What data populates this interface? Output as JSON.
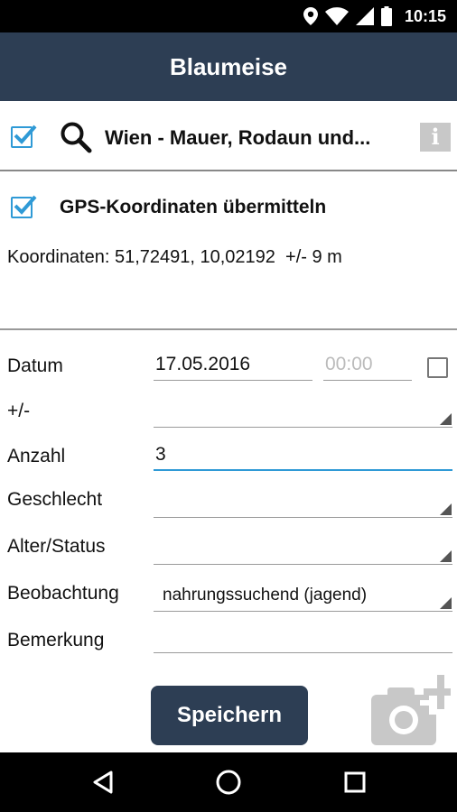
{
  "status_bar": {
    "time": "10:15",
    "icons": [
      "location-icon",
      "wifi-icon",
      "signal-icon",
      "battery-icon"
    ]
  },
  "app_bar": {
    "title": "Blaumeise"
  },
  "location": {
    "checked": true,
    "name": "Wien - Mauer, Rodaun und...",
    "info_label": "i"
  },
  "gps": {
    "checked": true,
    "label": "GPS-Koordinaten übermitteln",
    "coordinates_text": "Koordinaten: 51,72491, 10,02192  +/- 9 m"
  },
  "form": {
    "date": {
      "label": "Datum",
      "value": "17.05.2016",
      "time_placeholder": "00:00",
      "time_checked": false
    },
    "plus_minus": {
      "label": "+/-",
      "value": ""
    },
    "count": {
      "label": "Anzahl",
      "value": "3"
    },
    "sex": {
      "label": "Geschlecht",
      "value": ""
    },
    "age_status": {
      "label": "Alter/Status",
      "value": ""
    },
    "observation": {
      "label": "Beobachtung",
      "value": "nahrungssuchend (jagend)"
    },
    "remark": {
      "label": "Bemerkung",
      "value": ""
    }
  },
  "actions": {
    "save_label": "Speichern"
  },
  "colors": {
    "primary": "#2d3e54",
    "accent": "#2f9ad6"
  }
}
